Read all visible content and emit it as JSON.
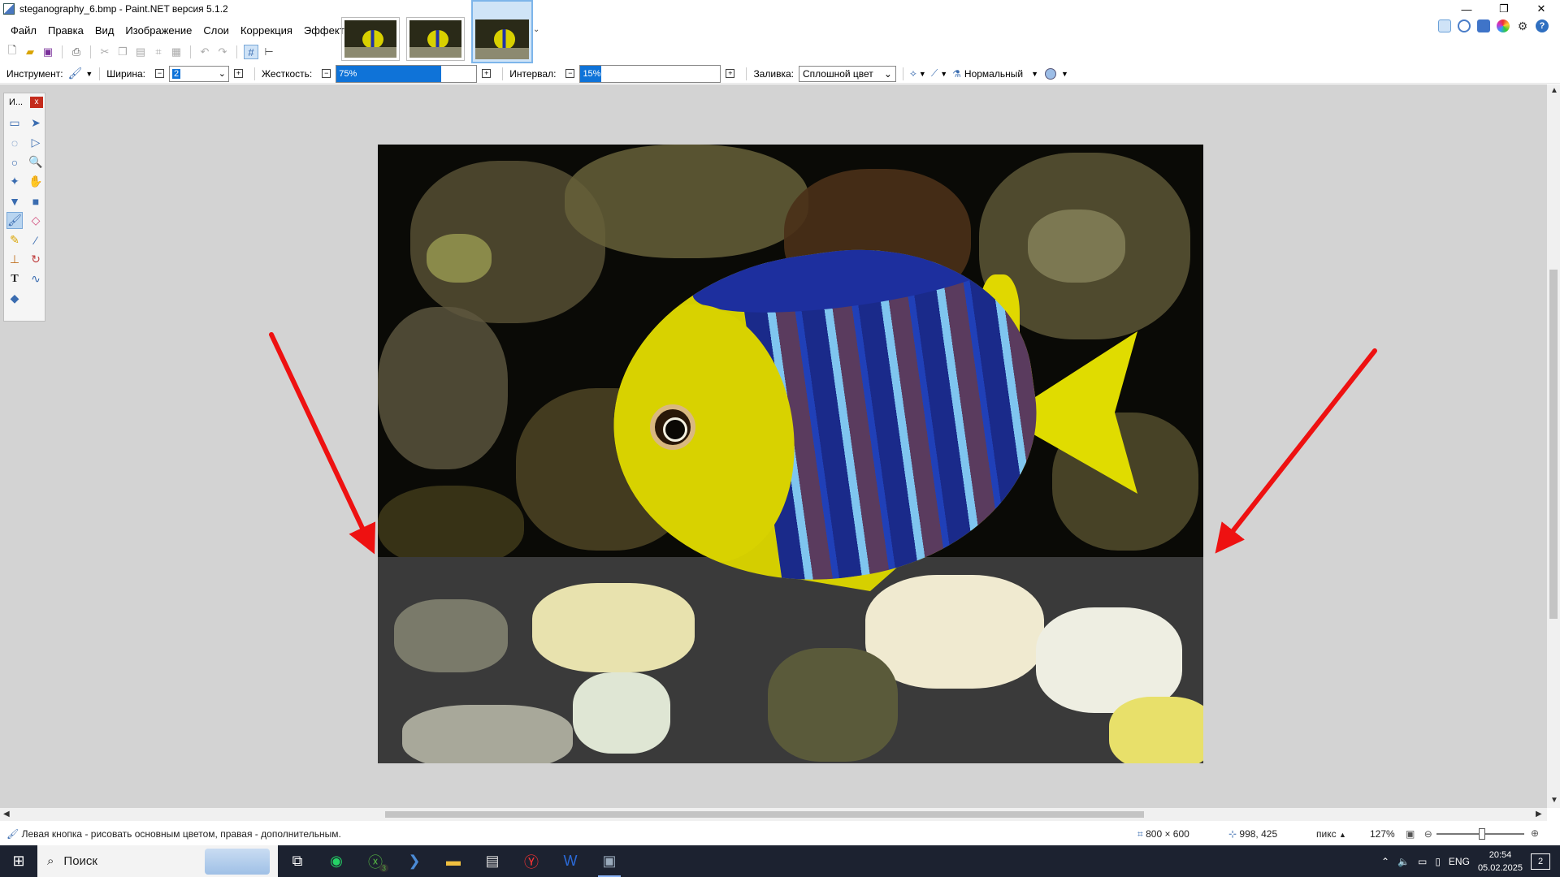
{
  "window": {
    "title": "steganography_6.bmp - Paint.NET версия 5.1.2",
    "controls": {
      "minimize": "—",
      "restore": "❐",
      "close": "✕"
    }
  },
  "menu": [
    {
      "label": "Файл"
    },
    {
      "label": "Правка"
    },
    {
      "label": "Вид"
    },
    {
      "label": "Изображение"
    },
    {
      "label": "Слои"
    },
    {
      "label": "Коррекция"
    },
    {
      "label": "Эффекты"
    }
  ],
  "toolbar2": {
    "tool_label": "Инструмент:",
    "width_label": "Ширина:",
    "width_value": "2",
    "hardness_label": "Жесткость:",
    "hardness_value": "75%",
    "hardness_fraction": 0.75,
    "spacing_label": "Интервал:",
    "spacing_value": "15%",
    "spacing_fraction": 0.15,
    "fill_label": "Заливка:",
    "fill_value": "Сплошной цвет",
    "blend_value": "Нормальный"
  },
  "tools_panel": {
    "title": "И...",
    "close": "x"
  },
  "status": {
    "hint": "Левая кнопка - рисовать основным цветом, правая - дополнительным.",
    "image_size": "800 × 600",
    "cursor": "998, 425",
    "unit": "пикс",
    "zoom": "127%"
  },
  "taskbar": {
    "search_placeholder": "Поиск",
    "lang": "ENG",
    "time": "20:54",
    "date": "05.02.2025",
    "notifications": "2",
    "xbox_badge": "3"
  },
  "colors": {
    "accent": "#0f73d8",
    "arrow": "#ee1111",
    "canvas_bg": "#d3d3d3",
    "taskbar": "#1c2230"
  }
}
